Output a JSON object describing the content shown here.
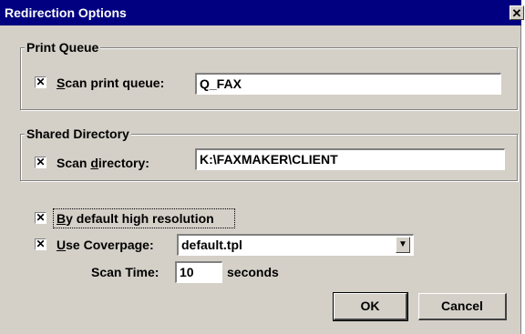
{
  "window": {
    "title": "Redirection Options",
    "close_glyph": "✕"
  },
  "print_queue": {
    "legend": "Print Queue",
    "checkbox": {
      "checked": true,
      "mark": "✕"
    },
    "label_accel": "S",
    "label_rest": "can print queue:",
    "value": "Q_FAX"
  },
  "shared_directory": {
    "legend": "Shared Directory",
    "checkbox": {
      "checked": true,
      "mark": "✕"
    },
    "label_pre": "Scan ",
    "label_accel": "d",
    "label_rest": "irectory:",
    "value": "K:\\FAXMAKER\\CLIENT"
  },
  "high_resolution": {
    "checkbox": {
      "checked": true,
      "mark": "✕"
    },
    "label_accel": "B",
    "label_rest": "y default high resolution"
  },
  "coverpage": {
    "checkbox": {
      "checked": true,
      "mark": "✕"
    },
    "label_accel": "U",
    "label_rest": "se Coverpage:",
    "selected": "default.tpl",
    "dropdown_icon": "▼"
  },
  "scan_time": {
    "label": "Scan Time:",
    "value": "10",
    "unit": "seconds"
  },
  "buttons": {
    "ok": "OK",
    "cancel": "Cancel"
  }
}
